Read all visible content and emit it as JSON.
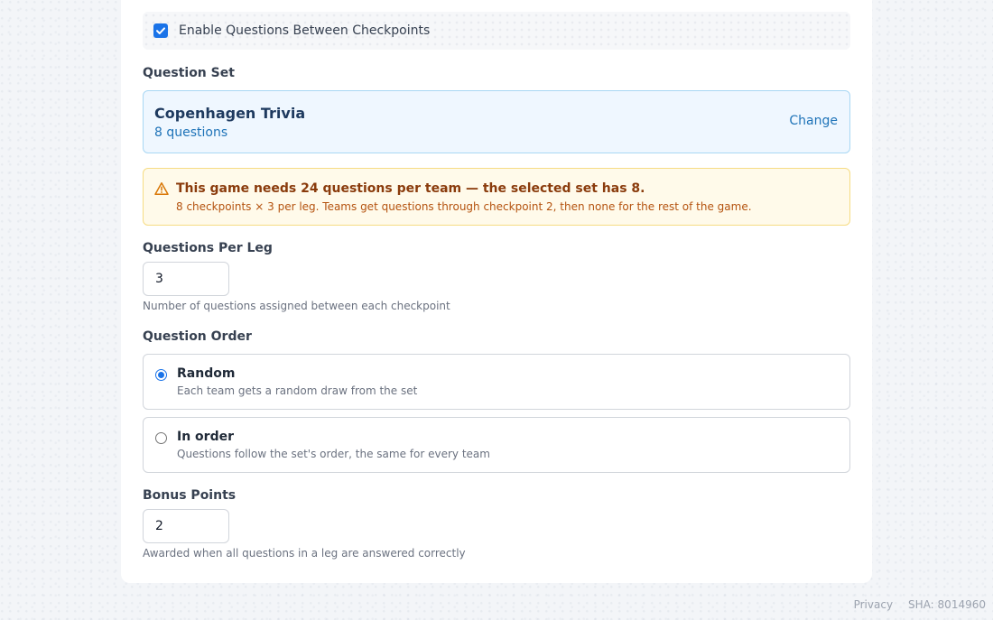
{
  "enable_questions": {
    "label": "Enable Questions Between Checkpoints",
    "checked": true
  },
  "question_set": {
    "section_label": "Question Set",
    "name": "Copenhagen Trivia",
    "count": "8 questions",
    "change_label": "Change"
  },
  "warning": {
    "icon": "warning-triangle-icon",
    "title": "This game needs 24 questions per team — the selected set has 8.",
    "detail": "8 checkpoints × 3 per leg. Teams get questions through checkpoint 2, then none for the rest of the game."
  },
  "questions_per_leg": {
    "label": "Questions Per Leg",
    "value": "3",
    "helper": "Number of questions assigned between each checkpoint"
  },
  "question_order": {
    "label": "Question Order",
    "options": [
      {
        "title": "Random",
        "description": "Each team gets a random draw from the set",
        "selected": true
      },
      {
        "title": "In order",
        "description": "Questions follow the set's order, the same for every team",
        "selected": false
      }
    ]
  },
  "bonus_points": {
    "label": "Bonus Points",
    "value": "2",
    "helper": "Awarded when all questions in a leg are answered correctly"
  },
  "footer": {
    "privacy": "Privacy",
    "sha": "SHA: 8014960"
  },
  "colors": {
    "accent": "#1a73e8",
    "link": "#1e73b8",
    "warning_bg": "#fffaea",
    "warning_border": "#f6dc83",
    "warning_title": "#8a3b0c"
  }
}
